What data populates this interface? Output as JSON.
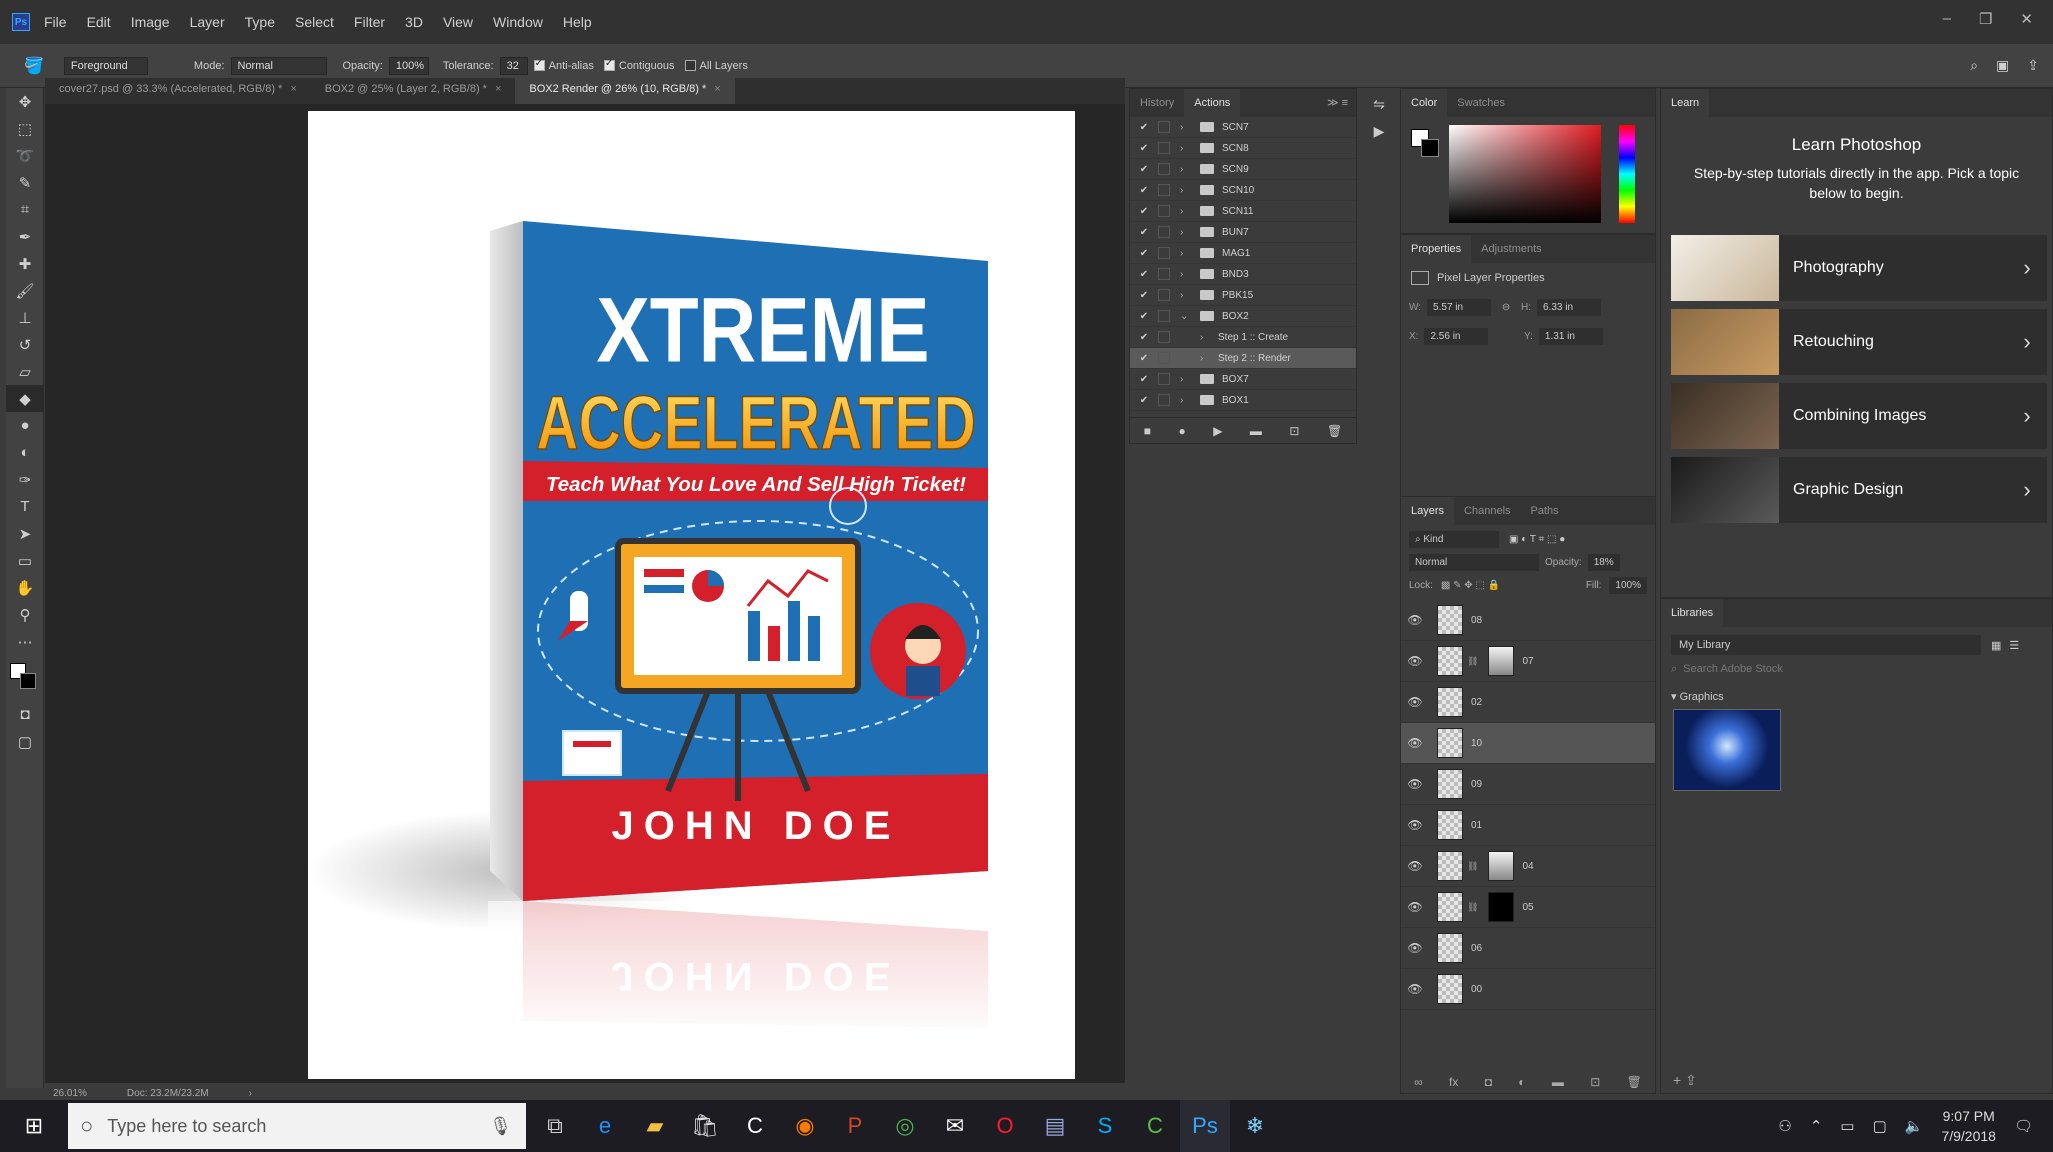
{
  "menu": [
    "File",
    "Edit",
    "Image",
    "Layer",
    "Type",
    "Select",
    "Filter",
    "3D",
    "View",
    "Window",
    "Help"
  ],
  "options": {
    "preset": "Foreground",
    "mode_label": "Mode:",
    "mode": "Normal",
    "opacity_label": "Opacity:",
    "opacity": "100%",
    "tolerance_label": "Tolerance:",
    "tolerance": "32",
    "antialias": "Anti-alias",
    "contiguous": "Contiguous",
    "all_layers": "All Layers"
  },
  "tabs": [
    {
      "label": "cover27.psd @ 33.3% (Accelerated, RGB/8) *"
    },
    {
      "label": "BOX2 @ 25% (Layer 2, RGB/8) *"
    },
    {
      "label": "BOX2 Render @ 26% (10, RGB/8) *"
    }
  ],
  "book": {
    "title_line1": "XTREME",
    "title_line2": "ACCELERATED",
    "subtitle": "Teach What You Love And Sell High Ticket!",
    "author": "JOHN DOE"
  },
  "status": {
    "zoom": "26.01%",
    "doc": "Doc: 23.2M/23.2M"
  },
  "actions_panel": {
    "tabs": [
      "History",
      "Actions"
    ],
    "rows": [
      {
        "name": "SCN7",
        "type": "folder"
      },
      {
        "name": "SCN8",
        "type": "folder"
      },
      {
        "name": "SCN9",
        "type": "folder"
      },
      {
        "name": "SCN10",
        "type": "folder"
      },
      {
        "name": "SCN11",
        "type": "folder"
      },
      {
        "name": "BUN7",
        "type": "folder"
      },
      {
        "name": "MAG1",
        "type": "folder"
      },
      {
        "name": "BND3",
        "type": "folder"
      },
      {
        "name": "PBK15",
        "type": "folder"
      },
      {
        "name": "BOX2",
        "type": "folder"
      },
      {
        "name": "Step 1 :: Create",
        "type": "step"
      },
      {
        "name": "Step 2 :: Render",
        "type": "step"
      },
      {
        "name": "BOX7",
        "type": "folder"
      },
      {
        "name": "BOX1",
        "type": "folder"
      }
    ]
  },
  "color_panel": {
    "tabs": [
      "Color",
      "Swatches"
    ]
  },
  "properties_panel": {
    "tabs": [
      "Properties",
      "Adjustments"
    ],
    "heading": "Pixel Layer Properties",
    "w_label": "W:",
    "w": "5.57 in",
    "h_label": "H:",
    "h": "6.33 in",
    "x_label": "X:",
    "x": "2.56 in",
    "y_label": "Y:",
    "y": "1.31 in"
  },
  "layers_panel": {
    "tabs": [
      "Layers",
      "Channels",
      "Paths"
    ],
    "kind": "Kind",
    "blend": "Normal",
    "opacity_label": "Opacity:",
    "opacity": "18%",
    "lock_label": "Lock:",
    "fill_label": "Fill:",
    "fill": "100%",
    "layers": [
      {
        "name": "08",
        "mask": false
      },
      {
        "name": "07",
        "mask": true
      },
      {
        "name": "02",
        "mask": false
      },
      {
        "name": "10",
        "mask": false
      },
      {
        "name": "09",
        "mask": false
      },
      {
        "name": "01",
        "mask": false
      },
      {
        "name": "04",
        "mask": true
      },
      {
        "name": "05",
        "mask": true
      },
      {
        "name": "06",
        "mask": false
      },
      {
        "name": "00",
        "mask": false
      }
    ]
  },
  "learn_panel": {
    "tab": "Learn",
    "title": "Learn Photoshop",
    "subtitle": "Step-by-step tutorials directly in the app. Pick a topic below to begin.",
    "topics": [
      "Photography",
      "Retouching",
      "Combining Images",
      "Graphic Design"
    ]
  },
  "libraries_panel": {
    "tab": "Libraries",
    "library": "My Library",
    "search_placeholder": "Search Adobe Stock",
    "section": "Graphics"
  },
  "taskbar": {
    "search_placeholder": "Type here to search",
    "time": "9:07 PM",
    "date": "7/9/2018"
  },
  "colors": {
    "accent": "#31a8ff",
    "book_blue": "#1f6fb4",
    "book_red": "#d3202a",
    "book_gold": "#f4b41a"
  }
}
